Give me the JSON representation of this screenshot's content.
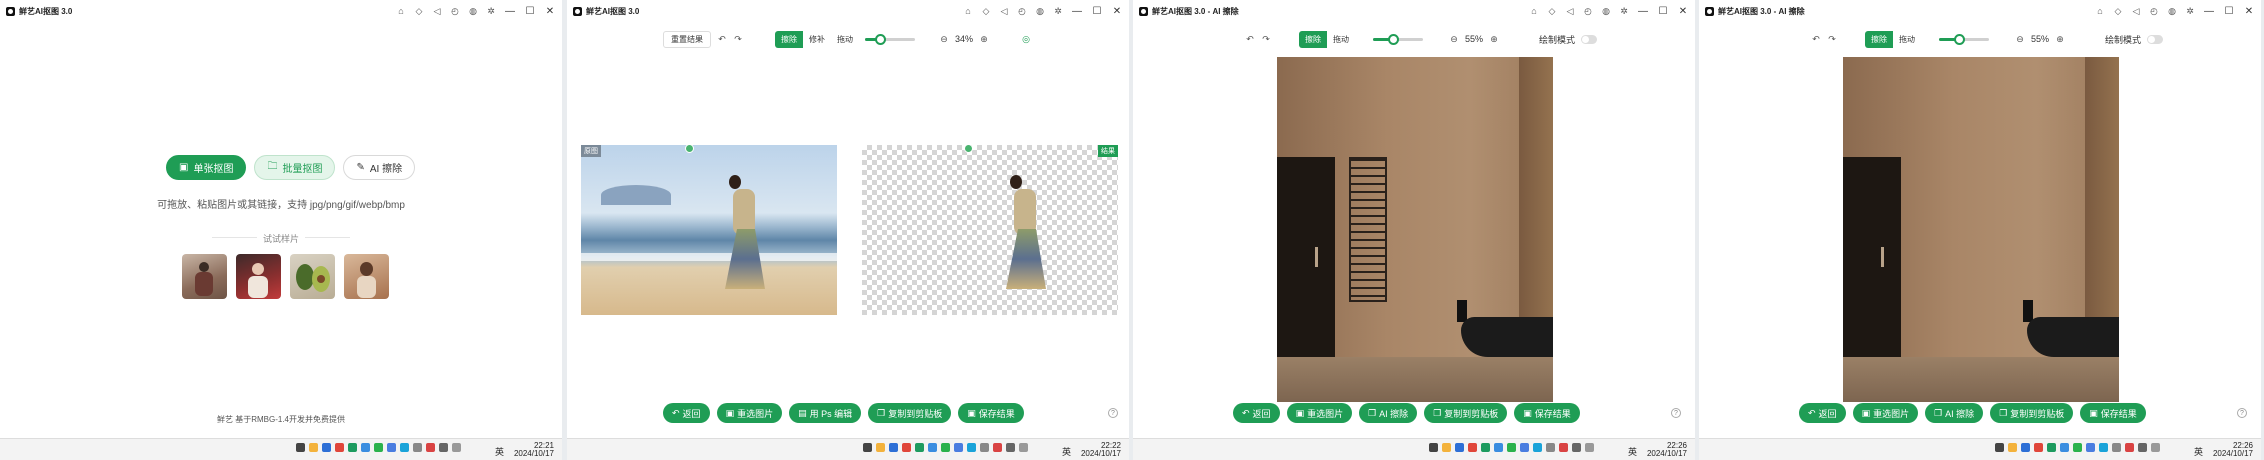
{
  "panels": [
    {
      "title": "鲜艺AI抠图  3.0",
      "clock_time": "22:21",
      "clock_date": "2024/10/17",
      "ime": "英"
    },
    {
      "title": "鲜艺AI抠图  3.0",
      "clock_time": "22:22",
      "clock_date": "2024/10/17",
      "ime": "英"
    },
    {
      "title": "鲜艺AI抠图  3.0 - AI 擦除",
      "clock_time": "22:26",
      "clock_date": "2024/10/17",
      "ime": "英"
    },
    {
      "title": "鲜艺AI抠图  3.0 - AI 擦除",
      "clock_time": "22:26",
      "clock_date": "2024/10/17",
      "ime": "英"
    }
  ],
  "home": {
    "single_label": "单张抠图",
    "batch_label": "批量抠图",
    "erase_label": "AI 擦除",
    "hint": "可拖放、粘贴图片或其链接，支持 jpg/png/gif/webp/bmp",
    "samples_title": "试试样片",
    "footer": "鲜艺 基于RMBG-1.4开发并免费提供"
  },
  "cutout": {
    "reset_label": "重置结果",
    "seg": [
      "擦除",
      "修补",
      "拖动"
    ],
    "zoom": "34%",
    "brush_level": 0.3,
    "original_tag": "原图",
    "result_tag": "结果",
    "buttons": [
      "返回",
      "重选图片",
      "用 Ps 编辑",
      "复制到剪贴板",
      "保存结果"
    ]
  },
  "erase": {
    "seg": [
      "擦除",
      "拖动"
    ],
    "zoom_a": "55%",
    "zoom_b": "55%",
    "brush_level": 0.4,
    "compare_label": "绘制模式",
    "buttons": [
      "返回",
      "重选图片",
      "AI 擦除",
      "复制到剪贴板",
      "保存结果"
    ]
  },
  "colors": {
    "accent": "#1f9d55"
  }
}
